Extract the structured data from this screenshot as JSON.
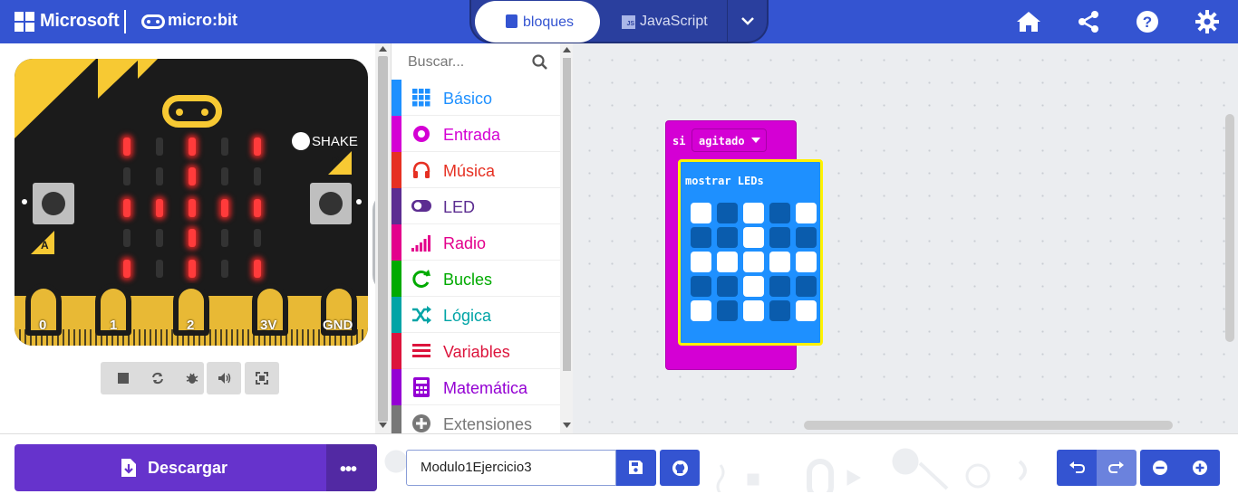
{
  "header": {
    "brand": "Microsoft",
    "product": "micro:bit",
    "tabs": [
      {
        "label": "bloques",
        "active": true
      },
      {
        "label": "JavaScript",
        "active": false
      }
    ],
    "js_badge": "JS",
    "icons": [
      "home-icon",
      "share-icon",
      "help-icon",
      "settings-icon"
    ]
  },
  "simulator": {
    "shake_label": "SHAKE",
    "button_a": "A",
    "button_b": "B",
    "pins": [
      "0",
      "1",
      "2",
      "3V",
      "GND"
    ],
    "led_matrix": [
      [
        1,
        0,
        1,
        0,
        1
      ],
      [
        0,
        0,
        1,
        0,
        0
      ],
      [
        1,
        1,
        1,
        1,
        1
      ],
      [
        0,
        0,
        1,
        0,
        0
      ],
      [
        1,
        0,
        1,
        0,
        1
      ]
    ],
    "controls": [
      "stop-icon",
      "restart-icon",
      "debug-icon",
      "sound-icon",
      "fullscreen-icon"
    ]
  },
  "toolbox": {
    "search_placeholder": "Buscar...",
    "categories": [
      {
        "label": "Básico",
        "color": "#1e90ff",
        "icon": "grid-icon"
      },
      {
        "label": "Entrada",
        "color": "#d400d4",
        "icon": "target-icon"
      },
      {
        "label": "Música",
        "color": "#e63022",
        "icon": "headphones-icon"
      },
      {
        "label": "LED",
        "color": "#5c2d91",
        "icon": "toggle-icon"
      },
      {
        "label": "Radio",
        "color": "#e3008c",
        "icon": "signal-bars-icon"
      },
      {
        "label": "Bucles",
        "color": "#00aa00",
        "icon": "loop-icon"
      },
      {
        "label": "Lógica",
        "color": "#00a4a6",
        "icon": "shuffle-icon"
      },
      {
        "label": "Variables",
        "color": "#dc143c",
        "icon": "list-icon"
      },
      {
        "label": "Matemática",
        "color": "#9400d3",
        "icon": "calculator-icon"
      },
      {
        "label": "Extensiones",
        "color": "#777777",
        "icon": "plus-circle-icon"
      }
    ]
  },
  "workspace": {
    "event_block": {
      "keyword": "si",
      "gesture": "agitado",
      "color": "#d400d4"
    },
    "led_block": {
      "label": "mostrar LEDs",
      "color": "#1e90ff",
      "pattern": [
        [
          1,
          0,
          1,
          0,
          1
        ],
        [
          0,
          0,
          1,
          0,
          0
        ],
        [
          1,
          1,
          1,
          1,
          1
        ],
        [
          0,
          0,
          1,
          0,
          0
        ],
        [
          1,
          0,
          1,
          0,
          1
        ]
      ]
    }
  },
  "footer": {
    "download_label": "Descargar",
    "more_label": "•••",
    "project_name": "Modulo1Ejercicio3"
  }
}
